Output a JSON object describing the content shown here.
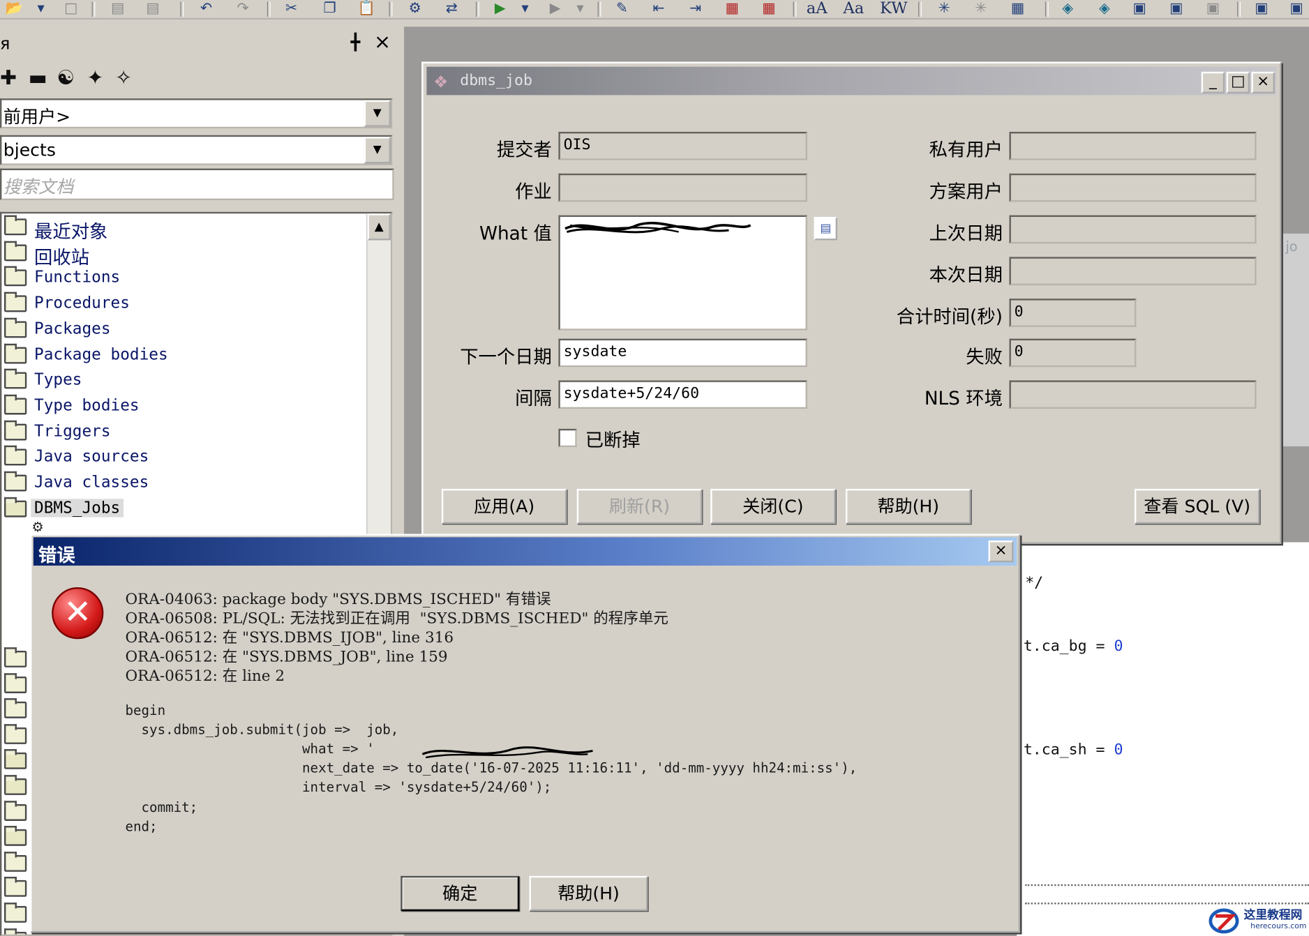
{
  "toolbar": {
    "text_buttons": [
      "aA",
      "Aa",
      "KW"
    ]
  },
  "left_panel": {
    "user_combo": "前用户>",
    "objects_combo": "bjects",
    "search_placeholder": "搜索文档",
    "tree_items": [
      {
        "label": "最近对象",
        "cjk": true
      },
      {
        "label": "回收站",
        "cjk": true
      },
      {
        "label": "Functions"
      },
      {
        "label": "Procedures"
      },
      {
        "label": "Packages"
      },
      {
        "label": "Package bodies"
      },
      {
        "label": "Types"
      },
      {
        "label": "Type bodies"
      },
      {
        "label": "Triggers"
      },
      {
        "label": "Java sources"
      },
      {
        "label": "Java classes"
      },
      {
        "label": "DBMS_Jobs",
        "selected": true
      }
    ]
  },
  "job_dialog": {
    "title": "dbms_job",
    "fields": {
      "submitter": {
        "label": "提交者",
        "value": "OIS"
      },
      "job": {
        "label": "作业",
        "value": ""
      },
      "what": {
        "label": "What 值",
        "value": ""
      },
      "next_date": {
        "label": "下一个日期",
        "value": "sysdate"
      },
      "interval": {
        "label": "间隔",
        "value": "sysdate+5/24/60"
      },
      "private_user": {
        "label": "私有用户",
        "value": ""
      },
      "schema_user": {
        "label": "方案用户",
        "value": ""
      },
      "last_date": {
        "label": "上次日期",
        "value": ""
      },
      "this_date": {
        "label": "本次日期",
        "value": ""
      },
      "total_time": {
        "label": "合计时间(秒)",
        "value": "0"
      },
      "failures": {
        "label": "失败",
        "value": "0"
      },
      "nls_env": {
        "label": "NLS 环境",
        "value": ""
      }
    },
    "broken_checkbox": {
      "label": "已断掉",
      "checked": false
    },
    "buttons": {
      "apply": "应用(A)",
      "refresh": "刷新(R)",
      "close": "关闭(C)",
      "help": "帮助(H)",
      "view_sql": "查看 SQL (V)"
    }
  },
  "error_dialog": {
    "title": "错误",
    "messages": [
      "ORA-04063: package body \"SYS.DBMS_ISCHED\" 有错误",
      "ORA-06508: PL/SQL: 无法找到正在调用  \"SYS.DBMS_ISCHED\" 的程序单元",
      "ORA-06512: 在 \"SYS.DBMS_IJOB\", line 316",
      "ORA-06512: 在 \"SYS.DBMS_JOB\", line 159",
      "ORA-06512: 在 line 2"
    ],
    "code": [
      "begin",
      "  sys.dbms_job.submit(job =>  job,",
      "                      what => '",
      "                      next_date => to_date('16-07-2025 11:16:11', 'dd-mm-yyyy hh24:mi:ss'),",
      "                      interval => 'sysdate+5/24/60');",
      "  commit;",
      "end;"
    ],
    "buttons": {
      "ok": "确定",
      "help": "帮助(H)"
    }
  },
  "editor": {
    "lines": [
      {
        "pre": "*/",
        "num": ""
      },
      {
        "pre": "t.ca_bg = ",
        "num": "0"
      },
      {
        "pre": "t.ca_sh = ",
        "num": "0"
      }
    ]
  },
  "watermark": {
    "name": "这里教程网",
    "url": "herecours.com"
  }
}
